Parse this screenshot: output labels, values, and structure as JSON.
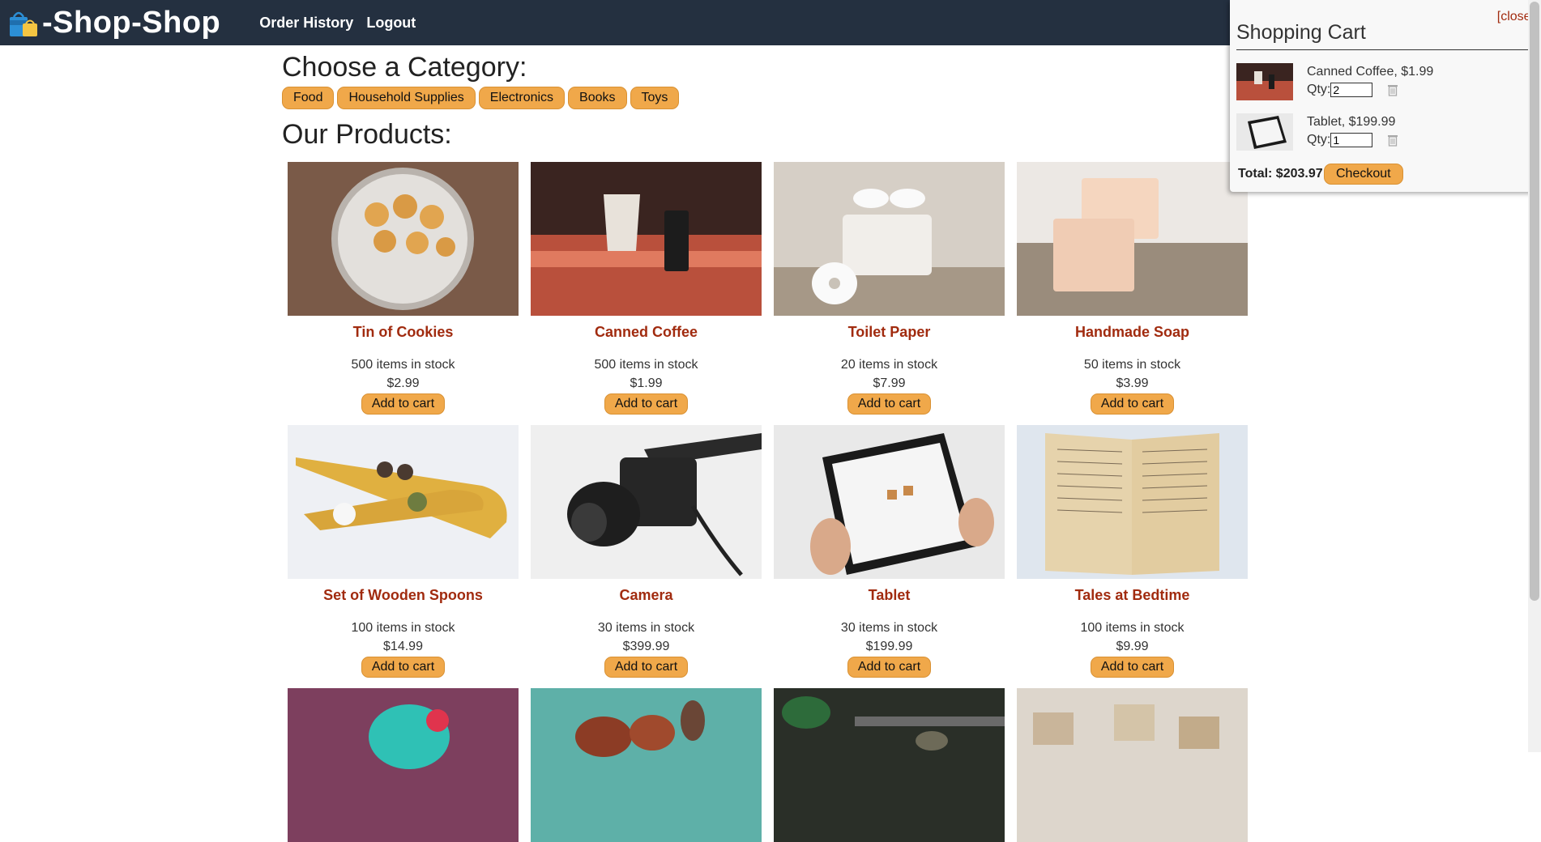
{
  "header": {
    "brand_title": "-Shop-Shop",
    "nav": [
      {
        "label": "Order History"
      },
      {
        "label": "Logout"
      }
    ]
  },
  "main": {
    "category_heading": "Choose a Category:",
    "categories": [
      "Food",
      "Household Supplies",
      "Electronics",
      "Books",
      "Toys"
    ],
    "products_heading": "Our Products:",
    "add_label": "Add to cart",
    "products": [
      {
        "name": "Tin of Cookies",
        "stock": "500 items in stock",
        "price": "$2.99"
      },
      {
        "name": "Canned Coffee",
        "stock": "500 items in stock",
        "price": "$1.99"
      },
      {
        "name": "Toilet Paper",
        "stock": "20 items in stock",
        "price": "$7.99"
      },
      {
        "name": "Handmade Soap",
        "stock": "50 items in stock",
        "price": "$3.99"
      },
      {
        "name": "Set of Wooden Spoons",
        "stock": "100 items in stock",
        "price": "$14.99"
      },
      {
        "name": "Camera",
        "stock": "30 items in stock",
        "price": "$399.99"
      },
      {
        "name": "Tablet",
        "stock": "30 items in stock",
        "price": "$199.99"
      },
      {
        "name": "Tales at Bedtime",
        "stock": "100 items in stock",
        "price": "$9.99"
      }
    ]
  },
  "cart": {
    "close_label": "[close]",
    "title": "Shopping Cart",
    "qty_label": "Qty:",
    "items": [
      {
        "label": "Canned Coffee, $1.99",
        "qty": "2"
      },
      {
        "label": "Tablet, $199.99",
        "qty": "1"
      }
    ],
    "total": "Total: $203.97",
    "checkout_label": "Checkout"
  },
  "colors": {
    "header_bg": "#243040",
    "accent": "#f0a84a",
    "product_name": "#a12b0f"
  }
}
